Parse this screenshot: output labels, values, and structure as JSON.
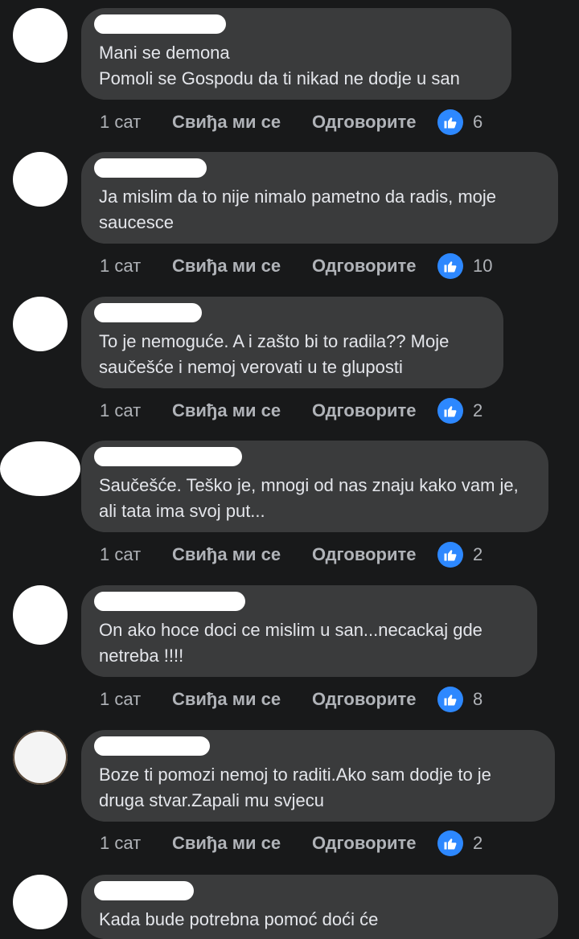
{
  "comments": [
    {
      "text": "Mani se demona\nPomoli se Gospodu da ti nikad ne dodje u san",
      "time": "1 сат",
      "like_label": "Свиђа ми се",
      "reply_label": "Одговорите",
      "reactions": "6"
    },
    {
      "text": "Ja mislim da to nije nimalo pametno da radis, moje saucesce",
      "time": "1 сат",
      "like_label": "Свиђа ми се",
      "reply_label": "Одговорите",
      "reactions": "10"
    },
    {
      "text": "To je nemoguće. A i zašto bi to radila?? Moje saučešće i nemoj verovati u te gluposti",
      "time": "1 сат",
      "like_label": "Свиђа ми се",
      "reply_label": "Одговорите",
      "reactions": "2"
    },
    {
      "text": "Saučešće. Teško je, mnogi od nas znaju kako vam je, ali tata ima svoj put...",
      "time": "1 сат",
      "like_label": "Свиђа ми се",
      "reply_label": "Одговорите",
      "reactions": "2"
    },
    {
      "text": "On ako hoce doci ce mislim u san...necackaj gde netreba !!!!",
      "time": "1 сат",
      "like_label": "Свиђа ми се",
      "reply_label": "Одговорите",
      "reactions": "8"
    },
    {
      "text": "Boze ti pomozi nemoj to raditi.Ako sam dodje to je druga stvar.Zapali mu svjecu",
      "time": "1 сат",
      "like_label": "Свиђа ми се",
      "reply_label": "Одговорите",
      "reactions": "2"
    },
    {
      "text": "Kada bude potrebna pomoć doći će"
    }
  ],
  "colors": {
    "background": "#18191a",
    "bubble": "#3a3b3c",
    "text": "#e4e6eb",
    "meta": "#b0b3b8",
    "like_accent": "#2d88ff"
  },
  "icons": {
    "reaction": "like-thumb-icon"
  }
}
